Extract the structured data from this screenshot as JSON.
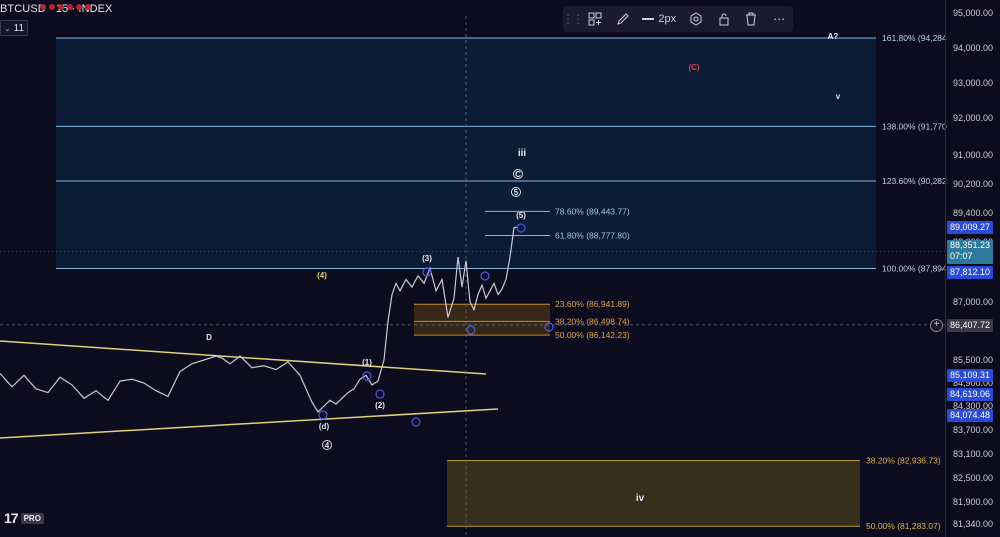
{
  "header": {
    "symbol": "BTCUSD · 15 · INDEX",
    "interval_badge": "11"
  },
  "toolbar": {
    "stroke_width": "2px"
  },
  "colors": {
    "bg": "#0d0c1e",
    "fib_zone": "#0f2a4a",
    "fib_line": "#7fb8d8",
    "support_zone": "#6a5a1e",
    "yellow_line": "#d9d27a",
    "price_blue": "#2a4ad8"
  },
  "chart_data": {
    "type": "line",
    "title": "",
    "xlabel": "",
    "ylabel": "",
    "ylim": [
      81000,
      95500
    ],
    "y_ticks": [
      "95,000.00",
      "94,000.00",
      "93,000.00",
      "92,000.00",
      "91,000.00",
      "90,200.00",
      "89,400.00",
      "88,600.00",
      "87,000.00",
      "85,500.00",
      "84,900.00",
      "84,300.00",
      "83,700.00",
      "83,100.00",
      "82,500.00",
      "81,900.00",
      "81,340.00"
    ],
    "price_tags": [
      {
        "label": "89,009.27",
        "value": 89009.27,
        "style": "blue"
      },
      {
        "label": "88,351.23",
        "sub": "07:07",
        "value": 88351.23,
        "style": "teal"
      },
      {
        "label": "87,812.10",
        "value": 87812.1,
        "style": "blue"
      },
      {
        "label": "86,407.72",
        "value": 86407.72,
        "style": "crosshair"
      },
      {
        "label": "85,109.31",
        "value": 85109.31,
        "style": "blue"
      },
      {
        "label": "84,619.06",
        "value": 84619.06,
        "style": "blue"
      },
      {
        "label": "84,074.48",
        "value": 84074.48,
        "style": "blue"
      }
    ],
    "fib_levels_upper": [
      {
        "label": "161.80% (94,284",
        "value": 94284
      },
      {
        "label": "138.00% (91,770",
        "value": 91770
      },
      {
        "label": "123.60% (90,282",
        "value": 90282
      },
      {
        "label": "100.00% (87,894",
        "value": 87894
      }
    ],
    "fib_levels_inner": [
      {
        "label": "78.60% (89,443.77)",
        "value": 89443.77
      },
      {
        "label": "61.80% (88,777.80)",
        "value": 88777.8
      }
    ],
    "fib_levels_lower": [
      {
        "label": "23.60% (86,941.89)",
        "value": 86941.89
      },
      {
        "label": "38.20% (86,498.74)",
        "value": 86498.74
      },
      {
        "label": "50.00% (86,142.23)",
        "value": 86142.23
      }
    ],
    "fib_levels_support": [
      {
        "label": "38.20% (82,936.73)",
        "value": 82936.73
      },
      {
        "label": "50.00% (81,283.07)",
        "value": 81283.07
      }
    ],
    "wave_labels": [
      "A?",
      "(C)",
      "v",
      "iii",
      "C",
      "5",
      "(5)",
      "(3)",
      "(4)",
      "D",
      "(1)",
      "(2)",
      "(d)",
      "4",
      "iv"
    ],
    "price_series": {
      "x": [
        0,
        12,
        24,
        36,
        48,
        60,
        72,
        84,
        96,
        108,
        120,
        132,
        144,
        156,
        168,
        180,
        192,
        204,
        216,
        222,
        230,
        240,
        252,
        264,
        276,
        288,
        300,
        312,
        318,
        324,
        330,
        336,
        342,
        348,
        354,
        360,
        366,
        372,
        378,
        384,
        388,
        392,
        396,
        400,
        406,
        412,
        418,
        424,
        430,
        436,
        442,
        448,
        454,
        458,
        462,
        466,
        470,
        474,
        478,
        482,
        486,
        490,
        494,
        498,
        502,
        506,
        510,
        514,
        518
      ],
      "y": [
        85150,
        84800,
        85100,
        84750,
        84650,
        85050,
        84850,
        84500,
        84700,
        84450,
        84950,
        85000,
        84900,
        84700,
        84550,
        85200,
        85400,
        85500,
        85600,
        85550,
        85400,
        85600,
        85300,
        85350,
        85250,
        85450,
        85100,
        84400,
        84150,
        84300,
        84450,
        84350,
        84500,
        84650,
        84750,
        85000,
        85100,
        84850,
        84950,
        85500,
        86500,
        87200,
        87500,
        87300,
        87600,
        87400,
        87700,
        87500,
        87900,
        87300,
        87600,
        86600,
        87100,
        88200,
        87400,
        88100,
        87000,
        86800,
        87200,
        87450,
        87100,
        87300,
        87500,
        87200,
        87350,
        87600,
        88200,
        89000,
        89009
      ]
    }
  }
}
